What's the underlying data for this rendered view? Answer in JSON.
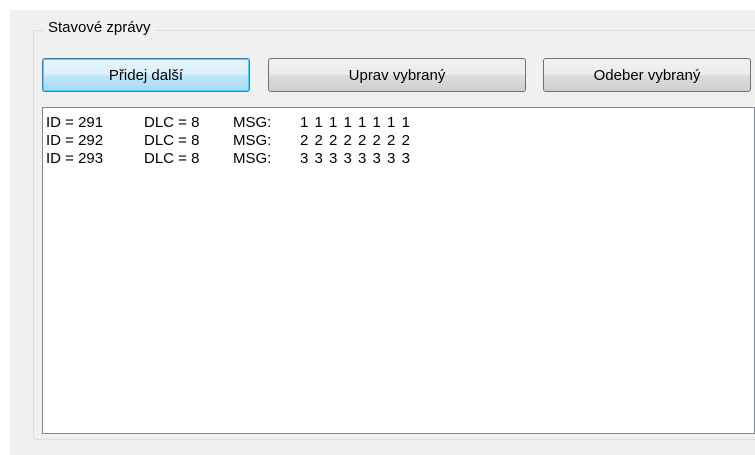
{
  "group": {
    "title": "Stavové zprávy"
  },
  "buttons": {
    "add_label": "Přidej další",
    "edit_label": "Uprav vybraný",
    "remove_label": "Odeber vybraný"
  },
  "messages": [
    {
      "id": "ID = 291",
      "dlc": "DLC = 8",
      "msg_label": "MSG:",
      "data": "1 1 1 1 1 1 1 1"
    },
    {
      "id": "ID = 292",
      "dlc": "DLC = 8",
      "msg_label": "MSG:",
      "data": "2 2 2 2 2 2 2 2"
    },
    {
      "id": "ID = 293",
      "dlc": "DLC = 8",
      "msg_label": "MSG:",
      "data": "3 3 3 3 3 3 3 3"
    }
  ]
}
